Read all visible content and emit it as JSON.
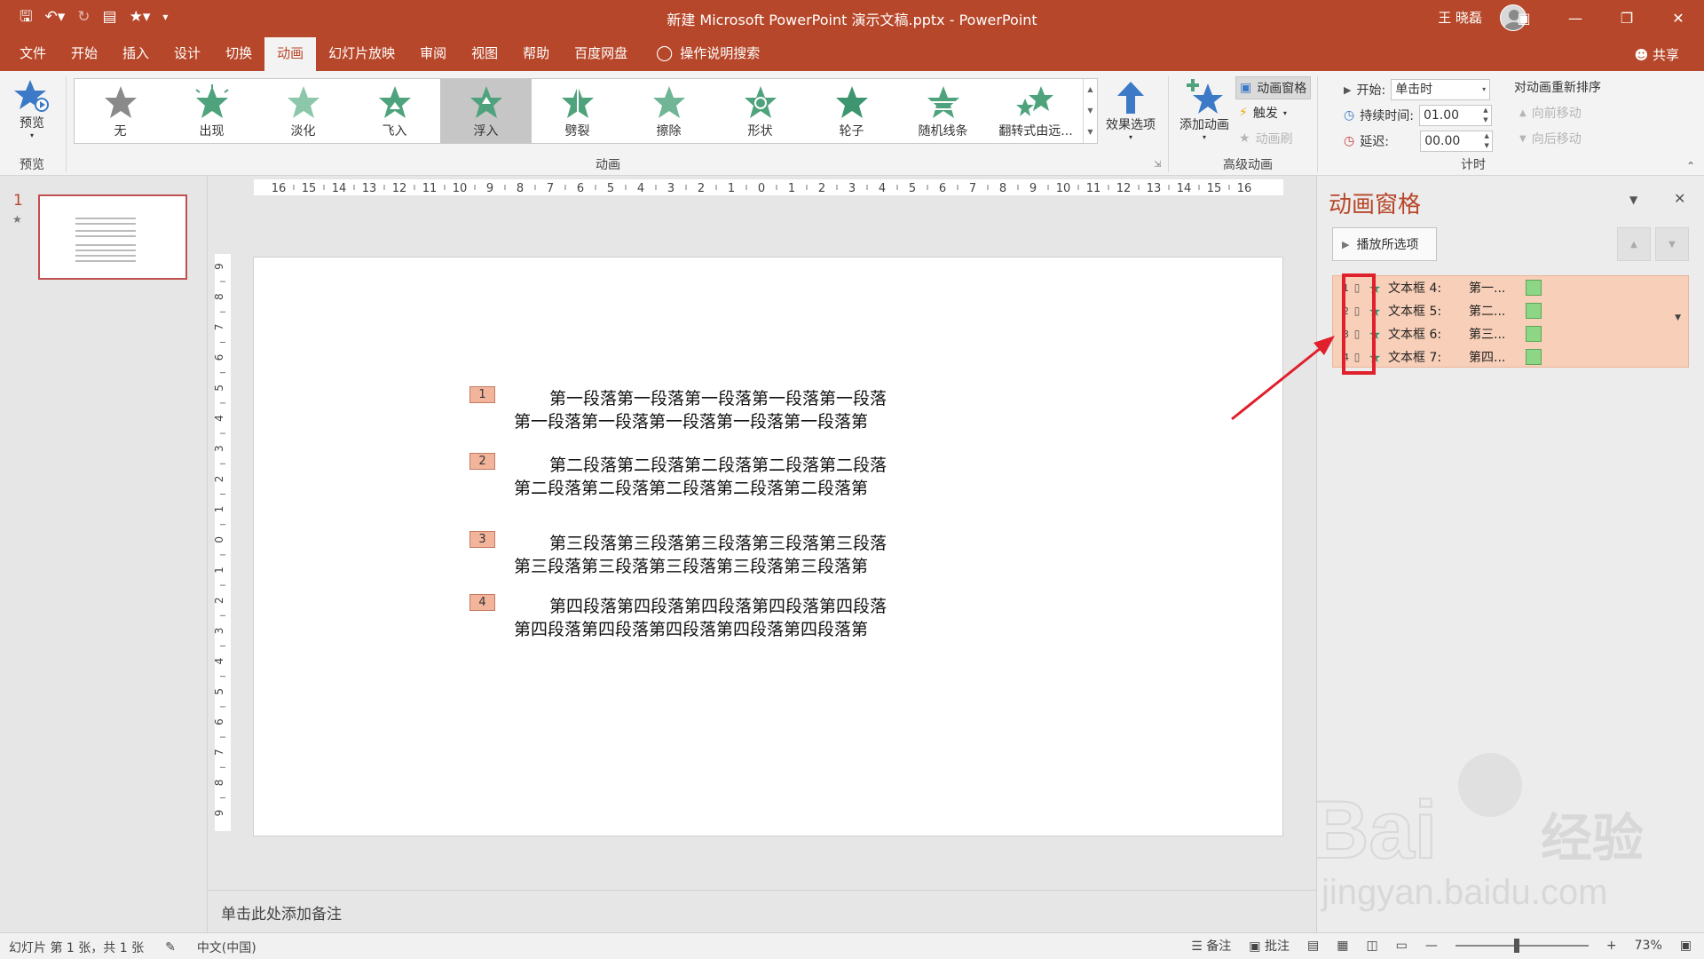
{
  "app": {
    "window_title": "新建 Microsoft PowerPoint 演示文稿.pptx  -  PowerPoint",
    "user_name": "王 晓磊",
    "share_label": "共享"
  },
  "qat": [
    "save-icon",
    "undo-icon",
    "redo-icon",
    "present-icon",
    "star-icon",
    "customize-icon"
  ],
  "menu": {
    "tabs": [
      "文件",
      "开始",
      "插入",
      "设计",
      "切换",
      "动画",
      "幻灯片放映",
      "审阅",
      "视图",
      "帮助",
      "百度网盘"
    ],
    "active_tab": "动画",
    "tell_me": "操作说明搜索"
  },
  "ribbon": {
    "preview": {
      "label": "预览",
      "group": "预览"
    },
    "animations": {
      "group": "动画",
      "items": [
        {
          "label": "无",
          "color": "#8a8a8a"
        },
        {
          "label": "出现",
          "color": "#4ea27c"
        },
        {
          "label": "淡化",
          "color": "#8cc7ab"
        },
        {
          "label": "飞入",
          "color": "#4ea27c"
        },
        {
          "label": "浮入",
          "color": "#4ea27c"
        },
        {
          "label": "劈裂",
          "color": "#4ea27c"
        },
        {
          "label": "擦除",
          "color": "#6fb596"
        },
        {
          "label": "形状",
          "color": "#4ea27c"
        },
        {
          "label": "轮子",
          "color": "#3e9670"
        },
        {
          "label": "随机线条",
          "color": "#4ea27c"
        },
        {
          "label": "翻转式由远..."
        }
      ],
      "selected": "浮入",
      "effect_options": "效果选项"
    },
    "advanced": {
      "group": "高级动画",
      "add_animation": "添加动画",
      "animation_pane": "动画窗格",
      "trigger": "触发",
      "painter": "动画刷"
    },
    "timing": {
      "group": "计时",
      "start_label": "开始:",
      "start_value": "单击时",
      "duration_label": "持续时间:",
      "duration_value": "01.00",
      "delay_label": "延迟:",
      "delay_value": "00.00",
      "reorder_title": "对动画重新排序",
      "move_earlier": "向前移动",
      "move_later": "向后移动"
    }
  },
  "slides_pane": {
    "number": "1"
  },
  "rulers": {
    "horizontal": [
      "16",
      "15",
      "14",
      "13",
      "12",
      "11",
      "10",
      "9",
      "8",
      "7",
      "6",
      "5",
      "4",
      "3",
      "2",
      "1",
      "0",
      "1",
      "2",
      "3",
      "4",
      "5",
      "6",
      "7",
      "8",
      "9",
      "10",
      "11",
      "12",
      "13",
      "14",
      "15",
      "16"
    ],
    "vertical": [
      "9",
      "8",
      "7",
      "6",
      "5",
      "4",
      "3",
      "2",
      "1",
      "0",
      "1",
      "2",
      "3",
      "4",
      "5",
      "6",
      "7",
      "8",
      "9"
    ]
  },
  "slide": {
    "paragraphs": [
      {
        "tag": "1",
        "line1": "第一段落第一段落第一段落第一段落第一段落",
        "line2": "第一段落第一段落第一段落第一段落第一段落第"
      },
      {
        "tag": "2",
        "line1": "第二段落第二段落第二段落第二段落第二段落",
        "line2": "第二段落第二段落第二段落第二段落第二段落第"
      },
      {
        "tag": "3",
        "line1": "第三段落第三段落第三段落第三段落第三段落",
        "line2": "第三段落第三段落第三段落第三段落第三段落第"
      },
      {
        "tag": "4",
        "line1": "第四段落第四段落第四段落第四段落第四段落",
        "line2": "第四段落第四段落第四段落第四段落第四段落第"
      }
    ]
  },
  "notes_placeholder": "单击此处添加备注",
  "anim_pane": {
    "title": "动画窗格",
    "play_label": "播放所选项",
    "items": [
      {
        "index": "1",
        "target": "文本框 4:",
        "desc": "第一..."
      },
      {
        "index": "2",
        "target": "文本框 5:",
        "desc": "第二..."
      },
      {
        "index": "3",
        "target": "文本框 6:",
        "desc": "第三..."
      },
      {
        "index": "4",
        "target": "文本框 7:",
        "desc": "第四..."
      }
    ],
    "highlight_color": "#e0202c"
  },
  "watermark": {
    "text": "Baidu经验",
    "url": "jingyan.baidu.com"
  },
  "status": {
    "slide_info": "幻灯片 第 1 张，共 1 张",
    "language": "中文(中国)",
    "notes_label": "备注",
    "comments_label": "批注",
    "zoom": "73%"
  },
  "colors": {
    "accent": "#b7472a",
    "ribbon_bg": "#f3f3f3"
  }
}
